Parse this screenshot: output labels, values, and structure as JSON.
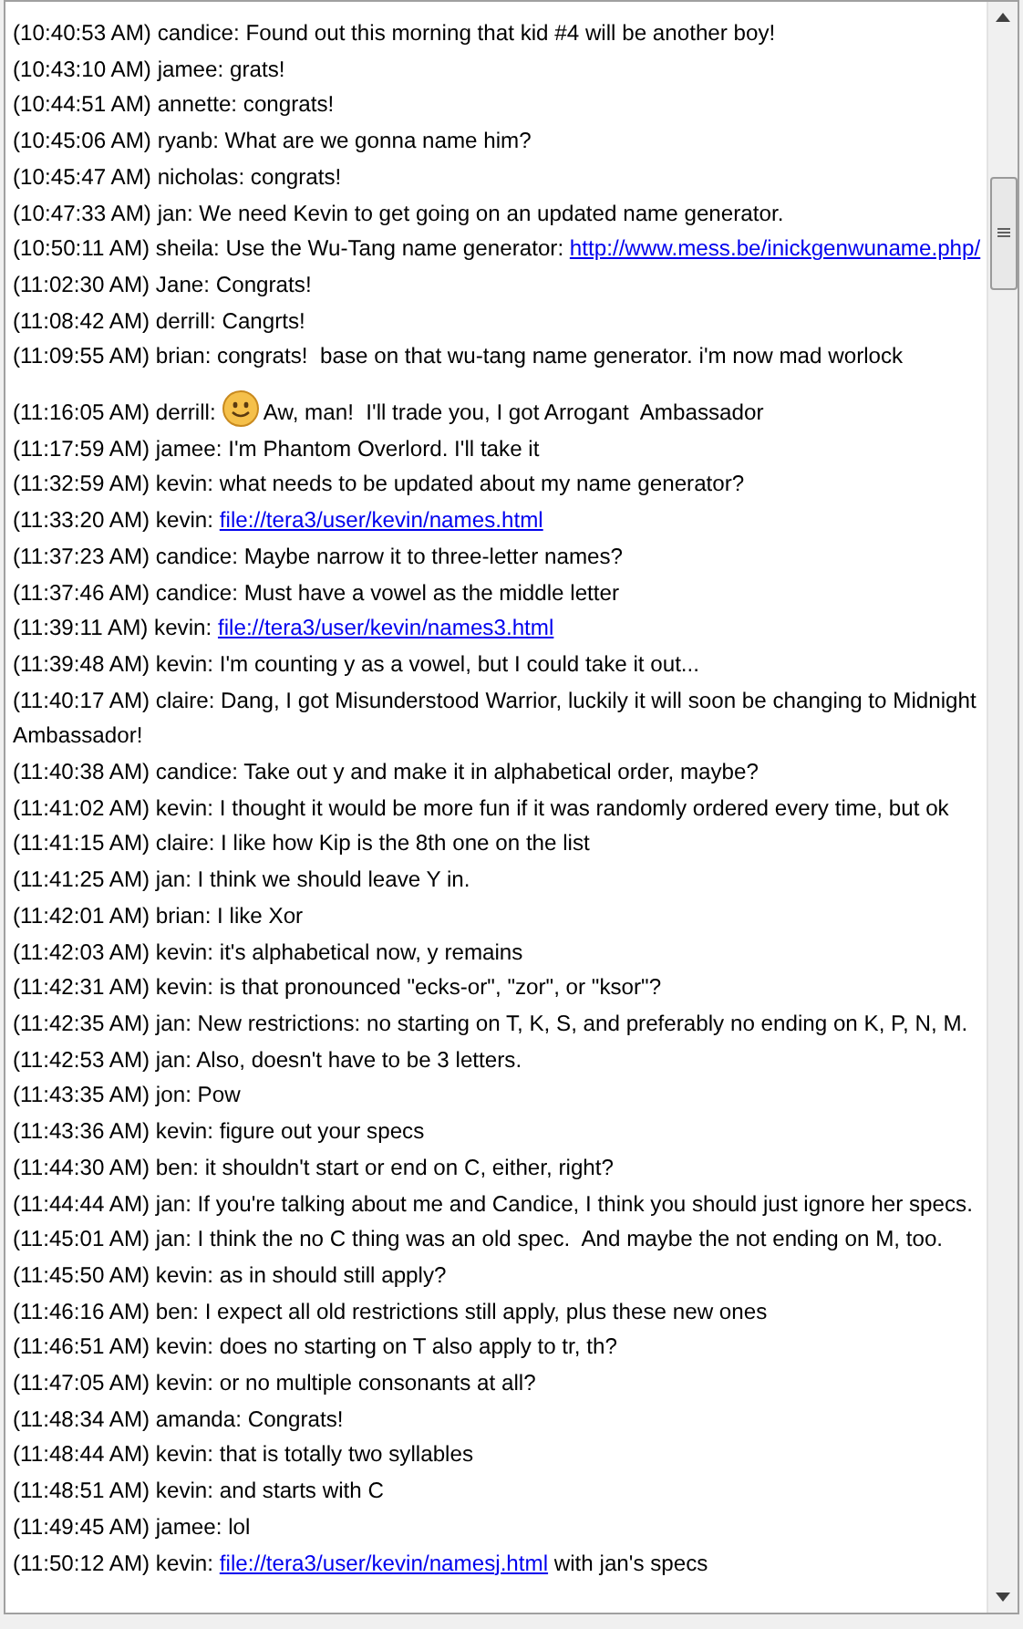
{
  "messages": [
    {
      "parts": [
        {
          "kind": "text",
          "text": "(10:40:53 AM) candice: Found out this morning that kid #4 will be another boy!"
        }
      ]
    },
    {
      "parts": [
        {
          "kind": "text",
          "text": "(10:43:10 AM) jamee: grats!"
        }
      ]
    },
    {
      "parts": [
        {
          "kind": "text",
          "text": "(10:44:51 AM) annette: congrats!"
        }
      ]
    },
    {
      "parts": [
        {
          "kind": "text",
          "text": "(10:45:06 AM) ryanb: What are we gonna name him?"
        }
      ]
    },
    {
      "parts": [
        {
          "kind": "text",
          "text": "(10:45:47 AM) nicholas: congrats!"
        }
      ]
    },
    {
      "parts": [
        {
          "kind": "text",
          "text": "(10:47:33 AM) jan: We need Kevin to get going on an updated name generator."
        }
      ]
    },
    {
      "parts": [
        {
          "kind": "text",
          "text": "(10:50:11 AM) sheila: Use the Wu-Tang name generator: "
        },
        {
          "kind": "link",
          "text": "http://www.mess.be/inickgenwuname.php/"
        }
      ]
    },
    {
      "parts": [
        {
          "kind": "text",
          "text": "(11:02:30 AM) Jane: Congrats!"
        }
      ]
    },
    {
      "parts": [
        {
          "kind": "text",
          "text": "(11:08:42 AM) derrill: Cangrts!"
        }
      ]
    },
    {
      "parts": [
        {
          "kind": "text",
          "text": "(11:09:55 AM) brian: congrats!  base on that wu-tang name generator. i'm now mad worlock"
        }
      ]
    },
    {
      "parts": [
        {
          "kind": "text",
          "text": "(11:16:05 AM) derrill: "
        },
        {
          "kind": "emoticon"
        },
        {
          "kind": "text",
          "text": " Aw, man!  I'll trade you, I got Arrogant  Ambassador"
        }
      ]
    },
    {
      "parts": [
        {
          "kind": "text",
          "text": "(11:17:59 AM) jamee: I'm Phantom Overlord. I'll take it"
        }
      ]
    },
    {
      "parts": [
        {
          "kind": "text",
          "text": "(11:32:59 AM) kevin: what needs to be updated about my name generator?"
        }
      ]
    },
    {
      "parts": [
        {
          "kind": "text",
          "text": "(11:33:20 AM) kevin: "
        },
        {
          "kind": "link",
          "text": "file://tera3/user/kevin/names.html"
        }
      ]
    },
    {
      "parts": [
        {
          "kind": "text",
          "text": "(11:37:23 AM) candice: Maybe narrow it to three-letter names?"
        }
      ]
    },
    {
      "parts": [
        {
          "kind": "text",
          "text": "(11:37:46 AM) candice: Must have a vowel as the middle letter"
        }
      ]
    },
    {
      "parts": [
        {
          "kind": "text",
          "text": "(11:39:11 AM) kevin: "
        },
        {
          "kind": "link",
          "text": "file://tera3/user/kevin/names3.html"
        }
      ]
    },
    {
      "parts": [
        {
          "kind": "text",
          "text": "(11:39:48 AM) kevin: I'm counting y as a vowel, but I could take it out..."
        }
      ]
    },
    {
      "parts": [
        {
          "kind": "text",
          "text": "(11:40:17 AM) claire: Dang, I got Misunderstood Warrior, luckily it will soon be changing to Midnight Ambassador!"
        }
      ]
    },
    {
      "parts": [
        {
          "kind": "text",
          "text": "(11:40:38 AM) candice: Take out y and make it in alphabetical order, maybe?"
        }
      ]
    },
    {
      "parts": [
        {
          "kind": "text",
          "text": "(11:41:02 AM) kevin: I thought it would be more fun if it was randomly ordered every time, but ok"
        }
      ]
    },
    {
      "parts": [
        {
          "kind": "text",
          "text": "(11:41:15 AM) claire: I like how Kip is the 8th one on the list"
        }
      ]
    },
    {
      "parts": [
        {
          "kind": "text",
          "text": "(11:41:25 AM) jan: I think we should leave Y in."
        }
      ]
    },
    {
      "parts": [
        {
          "kind": "text",
          "text": "(11:42:01 AM) brian: I like Xor"
        }
      ]
    },
    {
      "parts": [
        {
          "kind": "text",
          "text": "(11:42:03 AM) kevin: it's alphabetical now, y remains"
        }
      ]
    },
    {
      "parts": [
        {
          "kind": "text",
          "text": "(11:42:31 AM) kevin: is that pronounced \"ecks-or\", \"zor\", or \"ksor\"?"
        }
      ]
    },
    {
      "parts": [
        {
          "kind": "text",
          "text": "(11:42:35 AM) jan: New restrictions: no starting on T, K, S, and preferably no ending on K, P, N, M."
        }
      ]
    },
    {
      "parts": [
        {
          "kind": "text",
          "text": "(11:42:53 AM) jan: Also, doesn't have to be 3 letters."
        }
      ]
    },
    {
      "parts": [
        {
          "kind": "text",
          "text": "(11:43:35 AM) jon: Pow"
        }
      ]
    },
    {
      "parts": [
        {
          "kind": "text",
          "text": "(11:43:36 AM) kevin: figure out your specs"
        }
      ]
    },
    {
      "parts": [
        {
          "kind": "text",
          "text": "(11:44:30 AM) ben: it shouldn't start or end on C, either, right?"
        }
      ]
    },
    {
      "parts": [
        {
          "kind": "text",
          "text": "(11:44:44 AM) jan: If you're talking about me and Candice, I think you should just ignore her specs."
        }
      ]
    },
    {
      "parts": [
        {
          "kind": "text",
          "text": "(11:45:01 AM) jan: I think the no C thing was an old spec.  And maybe the not ending on M, too."
        }
      ]
    },
    {
      "parts": [
        {
          "kind": "text",
          "text": "(11:45:50 AM) kevin: as in should still apply?"
        }
      ]
    },
    {
      "parts": [
        {
          "kind": "text",
          "text": "(11:46:16 AM) ben: I expect all old restrictions still apply, plus these new ones"
        }
      ]
    },
    {
      "parts": [
        {
          "kind": "text",
          "text": "(11:46:51 AM) kevin: does no starting on T also apply to tr, th?"
        }
      ]
    },
    {
      "parts": [
        {
          "kind": "text",
          "text": "(11:47:05 AM) kevin: or no multiple consonants at all?"
        }
      ]
    },
    {
      "parts": [
        {
          "kind": "text",
          "text": "(11:48:34 AM) amanda: Congrats!"
        }
      ]
    },
    {
      "parts": [
        {
          "kind": "text",
          "text": "(11:48:44 AM) kevin: that is totally two syllables"
        }
      ]
    },
    {
      "parts": [
        {
          "kind": "text",
          "text": "(11:48:51 AM) kevin: and starts with C"
        }
      ]
    },
    {
      "parts": [
        {
          "kind": "text",
          "text": "(11:49:45 AM) jamee: lol"
        }
      ]
    },
    {
      "parts": [
        {
          "kind": "text",
          "text": "(11:50:12 AM) kevin: "
        },
        {
          "kind": "link",
          "text": "file://tera3/user/kevin/namesj.html"
        },
        {
          "kind": "text",
          "text": " with jan's specs"
        }
      ]
    }
  ]
}
